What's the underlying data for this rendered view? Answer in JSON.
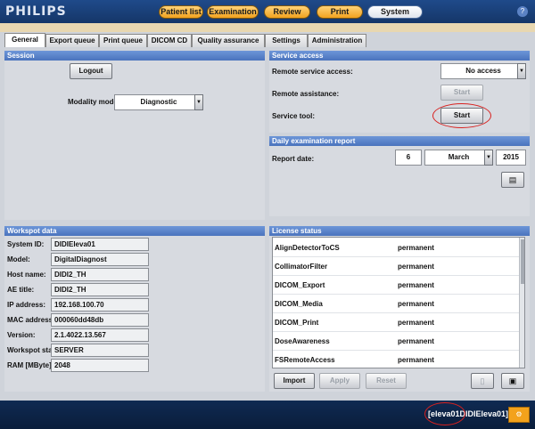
{
  "brand": "PHILIPS",
  "nav": [
    {
      "label": "Patient list"
    },
    {
      "label": "Examination"
    },
    {
      "label": "Review"
    },
    {
      "label": "Print"
    },
    {
      "label": "System",
      "active": true
    }
  ],
  "help_glyph": "?",
  "tabs": [
    {
      "label": "General",
      "active": true
    },
    {
      "label": "Export queue"
    },
    {
      "label": "Print queue"
    },
    {
      "label": "DICOM CD"
    },
    {
      "label": "Quality assurance"
    },
    {
      "label": "Settings"
    },
    {
      "label": "Administration"
    }
  ],
  "session": {
    "title": "Session",
    "logout_label": "Logout",
    "modality_label": "Modality mode:",
    "modality_value": "Diagnostic"
  },
  "service": {
    "title": "Service access",
    "remote_service_label": "Remote service access:",
    "remote_service_value": "No access",
    "remote_assist_label": "Remote assistance:",
    "remote_assist_button": "Start",
    "service_tool_label": "Service tool:",
    "service_tool_button": "Start"
  },
  "daily": {
    "title": "Daily examination report",
    "report_date_label": "Report date:",
    "day": "6",
    "month": "March",
    "year": "2015"
  },
  "workspot": {
    "title": "Workspot data",
    "rows": [
      {
        "label": "System ID:",
        "value": "DIDIEleva01"
      },
      {
        "label": "Model:",
        "value": "DigitalDiagnost"
      },
      {
        "label": "Host name:",
        "value": "DIDI2_TH"
      },
      {
        "label": "AE title:",
        "value": "DIDI2_TH"
      },
      {
        "label": "IP address:",
        "value": "192.168.100.70"
      },
      {
        "label": "MAC address:",
        "value": "000060dd48db"
      },
      {
        "label": "Version:",
        "value": "2.1.4022.13.567"
      },
      {
        "label": "Workspot status:",
        "value": "SERVER"
      },
      {
        "label": "RAM [MByte]:",
        "value": "2048"
      }
    ]
  },
  "license": {
    "title": "License status",
    "rows": [
      {
        "name": "AlignDetectorToCS",
        "status": "permanent"
      },
      {
        "name": "CollimatorFilter",
        "status": "permanent"
      },
      {
        "name": "DICOM_Export",
        "status": "permanent"
      },
      {
        "name": "DICOM_Media",
        "status": "permanent"
      },
      {
        "name": "DICOM_Print",
        "status": "permanent"
      },
      {
        "name": "DoseAwareness",
        "status": "permanent"
      },
      {
        "name": "FSRemoteAccess",
        "status": "permanent"
      }
    ],
    "import_label": "Import",
    "apply_label": "Apply",
    "reset_label": "Reset"
  },
  "footer": {
    "workstation_id": "[eleva01DIDIEleva01]"
  },
  "colors": {
    "nav_orange": "#f2a21f",
    "panel_header_blue": "#4a73bd",
    "annotation_red": "#d8211f"
  }
}
